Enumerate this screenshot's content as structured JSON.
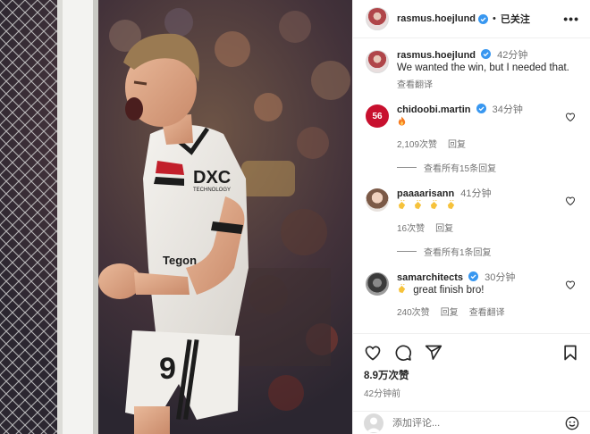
{
  "post": {
    "author": "rasmus.hoejlund",
    "follow_status": "已关注",
    "more_label": "•••",
    "caption_time": "42分钟",
    "caption_text": "We wanted the win, but I needed that.",
    "translate_label": "查看翻译"
  },
  "comments": [
    {
      "username": "chidoobi.martin",
      "time": "34分钟",
      "text": "",
      "emoji": [
        "fire"
      ],
      "likes": "2,109次赞",
      "reply_label": "回复",
      "extra_label": "",
      "view_replies": "查看所有15条回复",
      "avatar_number": "56"
    },
    {
      "username": "paaaarisann",
      "time": "41分钟",
      "text": "",
      "emoji": [
        "clap",
        "clap",
        "clap",
        "clap"
      ],
      "likes": "16次赞",
      "reply_label": "回复",
      "extra_label": "",
      "view_replies": "查看所有1条回复"
    },
    {
      "username": "samarchitects",
      "time": "30分钟",
      "text": "great finish bro!",
      "emoji": [
        "clap"
      ],
      "likes": "240次赞",
      "reply_label": "回复",
      "extra_label": "查看翻译",
      "view_replies": ""
    }
  ],
  "footer": {
    "likes": "8.9万次赞",
    "time": "42分钟前"
  },
  "composer": {
    "placeholder": "添加评论..."
  },
  "photo": {
    "shirt_sponsor": "DXC",
    "shirt_sponsor_sub": "TECHNOLOGY",
    "shirt_lower": "Tegon",
    "shirt_number": "9"
  },
  "colors": {
    "verified": "#3897f0",
    "text": "#262626",
    "muted": "#737373",
    "flame": "#f77b1f",
    "clap": "#f6c23b"
  },
  "icons": [
    "verified-badge-icon",
    "heart-icon",
    "comment-icon",
    "share-icon",
    "bookmark-icon",
    "smiley-icon",
    "fire-emoji-icon",
    "clap-emoji-icon"
  ]
}
